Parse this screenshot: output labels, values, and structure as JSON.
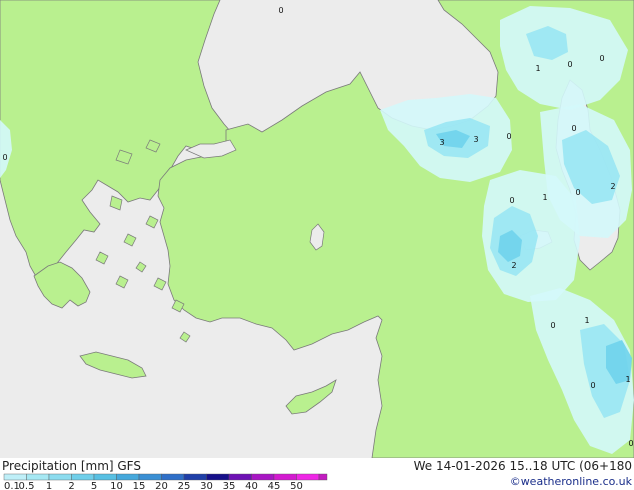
{
  "footer": {
    "title": "Precipitation [mm]  GFS",
    "valid": "We 14-01-2026 15..18 UTC (06+180",
    "credit": "©weatheronline.co.uk"
  },
  "legend": {
    "ticks": [
      "0.1",
      "0.5",
      "1",
      "2",
      "5",
      "10",
      "15",
      "20",
      "25",
      "30",
      "35",
      "40",
      "45",
      "50"
    ],
    "colors": [
      "#bfeff8",
      "#a6e8f3",
      "#8cdcef",
      "#70cfea",
      "#58c0e3",
      "#45a8dc",
      "#3a8fd4",
      "#2f6fc8",
      "#1f3fa8",
      "#16108a",
      "#6e12b4",
      "#a816c4",
      "#d31ad0",
      "#ef26e6",
      "#c21cc0"
    ]
  },
  "map": {
    "colors": {
      "sea": "#ececec",
      "land": "#b9f08f",
      "light_precip": "#d4f8fb",
      "moderate_precip": "#99e6f3",
      "heavy_precip": "#6fd3ec",
      "outline": "#7a7a7a"
    },
    "labels": [
      {
        "value": "0"
      },
      {
        "value": "0"
      },
      {
        "value": "1"
      },
      {
        "value": "0"
      },
      {
        "value": "0"
      },
      {
        "value": "3"
      },
      {
        "value": "3"
      },
      {
        "value": "0"
      },
      {
        "value": "0"
      },
      {
        "value": "0"
      },
      {
        "value": "2"
      },
      {
        "value": "0"
      },
      {
        "value": "1"
      },
      {
        "value": "2"
      },
      {
        "value": "0"
      },
      {
        "value": "1"
      },
      {
        "value": "0"
      },
      {
        "value": "1"
      },
      {
        "value": "0"
      }
    ]
  }
}
